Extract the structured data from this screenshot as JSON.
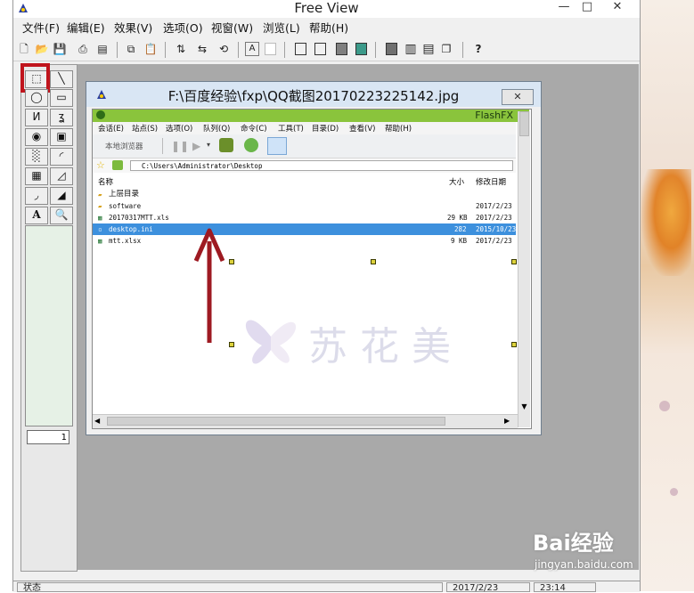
{
  "app": {
    "title": "Free View",
    "controls": {
      "minimize": "—",
      "maximize": "□",
      "close": "✕"
    }
  },
  "menubar": {
    "items": [
      {
        "label": "文件(F)"
      },
      {
        "label": "编辑(E)"
      },
      {
        "label": "效果(V)"
      },
      {
        "label": "选项(O)"
      },
      {
        "label": "视窗(W)"
      },
      {
        "label": "浏览(L)"
      },
      {
        "label": "帮助(H)"
      }
    ]
  },
  "toolbar": {
    "icons": [
      "new-icon",
      "open-icon",
      "save-icon",
      "print-icon",
      "properties-icon",
      "copy-icon",
      "paste-icon",
      "flip-vertical-icon",
      "flip-horizontal-icon",
      "rotate-icon",
      "text-icon",
      "white-box-icon",
      "square-icon",
      "square-outline-icon",
      "gray-square-icon",
      "teal-square-icon",
      "dark-square-icon",
      "columns-icon",
      "rows-icon",
      "tile-icon",
      "help-icon"
    ]
  },
  "toolbox": {
    "page_field_value": "1",
    "text_tool_label": "A",
    "icons": [
      "select-rect-icon",
      "line-icon",
      "ellipse-icon",
      "rectangle-icon",
      "polyline-icon",
      "freehand-icon",
      "filled-ellipse-icon",
      "filled-rect-icon",
      "spray-icon",
      "arc-icon",
      "gradient-icon",
      "polygon-icon",
      "curve-icon",
      "triangle-icon",
      "text-icon",
      "zoom-icon"
    ]
  },
  "document": {
    "title": "F:\\百度经验\\fxp\\QQ截图20170223225142.jpg",
    "close_label": "✕"
  },
  "screenshot_content": {
    "brand": "FlashFX",
    "menu": [
      "会话(E)",
      "站点(S)",
      "选项(O)",
      "队列(Q)",
      "命令(C)",
      "工具(T)",
      "目录(D)",
      "查看(V)",
      "帮助(H)"
    ],
    "local_label": "本地浏览器",
    "address": "C:\\Users\\Administrator\\Desktop",
    "columns": {
      "name": "名称",
      "size": "大小",
      "modified": "修改日期"
    },
    "rows": [
      {
        "name": "上层目录",
        "size": "",
        "modified": "",
        "selected": false
      },
      {
        "name": "software",
        "size": "",
        "modified": "2017/2/23",
        "selected": false
      },
      {
        "name": "20170317MTT.xls",
        "size": "29 KB",
        "modified": "2017/2/23",
        "selected": false
      },
      {
        "name": "desktop.ini",
        "size": "282",
        "modified": "2015/10/23",
        "selected": true
      },
      {
        "name": "mtt.xlsx",
        "size": "9 KB",
        "modified": "2017/2/23",
        "selected": false
      }
    ],
    "watermark_text": "苏 花 美"
  },
  "statusbar": {
    "status": "状态",
    "date": "2017/2/23",
    "time": "23:14"
  },
  "watermarks": {
    "baidu": "Bai经验",
    "site": "jingyan.baidu.com"
  },
  "colors": {
    "highlight_box": "#c0141c",
    "arrow": "#9e1a22",
    "flashfxp_green": "#8ac43c",
    "selection_blue": "#3d90dd"
  }
}
